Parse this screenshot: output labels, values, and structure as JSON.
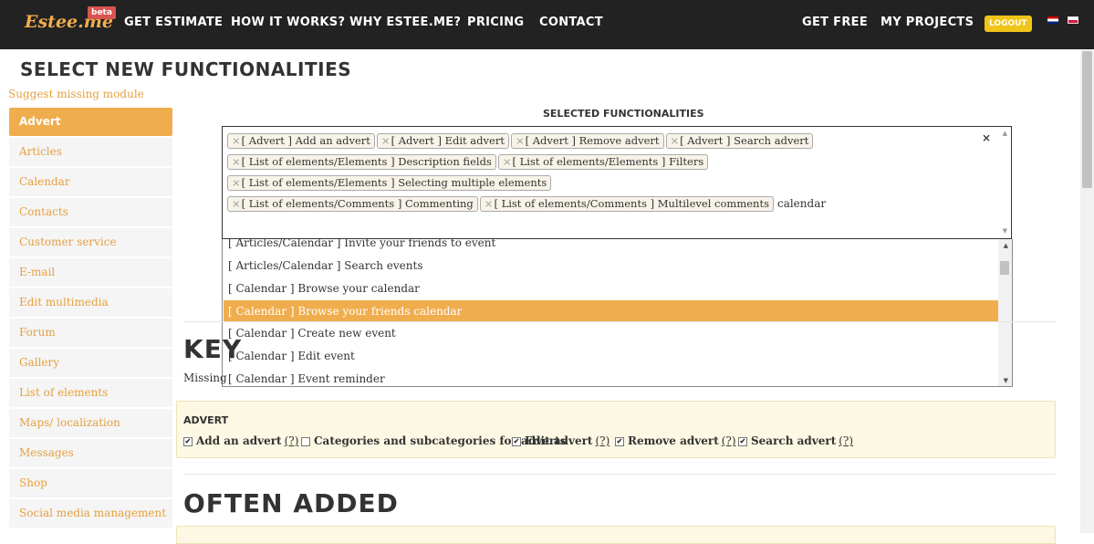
{
  "nav": {
    "logo": "Estee.me",
    "beta": "beta",
    "left_links": [
      "GET ESTIMATE",
      "HOW IT WORKS?",
      "WHY ESTEE.ME?",
      "PRICING",
      "CONTACT"
    ],
    "right_links": [
      "GET FREE",
      "MY PROJECTS"
    ],
    "logout": "LOGOUT",
    "languages": [
      "flag-en-icon",
      "flag-pl-icon"
    ]
  },
  "page": {
    "title": "SELECT NEW FUNCTIONALITIES",
    "suggest_link": "Suggest missing module"
  },
  "sidebar": {
    "items": [
      "Advert",
      "Articles",
      "Calendar",
      "Contacts",
      "Customer service",
      "E-mail",
      "Edit multimedia",
      "Forum",
      "Gallery",
      "List of elements",
      "Maps/ localization",
      "Messages",
      "Shop",
      "Social media management"
    ],
    "active": "Advert"
  },
  "selected": {
    "label": "SELECTED FUNCTIONALITIES",
    "tags": [
      "[ Advert ] Add an advert",
      "[ Advert ] Edit advert",
      "[ Advert ] Remove advert",
      "[ Advert ] Search advert",
      "[ List of elements/Elements ] Description fields",
      "[ List of elements/Elements ] Filters",
      "[ List of elements/Elements ] Selecting multiple elements",
      "[ List of elements/Comments ] Commenting",
      "[ List of elements/Comments ] Multilevel comments"
    ],
    "search_value": "calendar",
    "clear": "×"
  },
  "dropdown": {
    "items": [
      "[ Articles/Calendar ] Invite your friends to event",
      "[ Articles/Calendar ] Search events",
      "[ Calendar ] Browse your calendar",
      "[ Calendar ] Browse your friends calendar",
      "[ Calendar ] Create new event",
      "[ Calendar ] Edit event",
      "[ Calendar ] Event reminder"
    ],
    "highlighted": "[ Calendar ] Browse your friends calendar"
  },
  "key_section": {
    "heading": "KEY",
    "missing_text": "Missing"
  },
  "advert_panel": {
    "title": "ADVERT",
    "options": [
      {
        "label": "Add an advert",
        "checked": true,
        "help": "(?)"
      },
      {
        "label": "Categories and subcategories for adverts",
        "checked": false,
        "help": ""
      },
      {
        "label": "Edit advert",
        "checked": true,
        "help": "(?)"
      },
      {
        "label": "Remove advert",
        "checked": true,
        "help": "(?)"
      },
      {
        "label": "Search advert",
        "checked": true,
        "help": "(?)"
      }
    ]
  },
  "often_added": {
    "heading": "OFTEN ADDED"
  },
  "colors": {
    "accent": "#f0ad4e",
    "nav_bg": "#222222",
    "panel_bg": "#fcf8e3",
    "logout_bg": "#f0c419"
  }
}
